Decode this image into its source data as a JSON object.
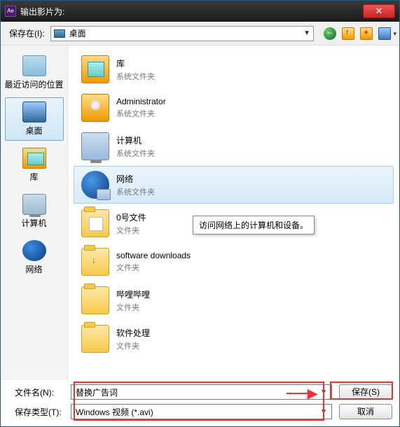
{
  "titlebar": {
    "app_badge": "Ae",
    "title": "输出影片为:"
  },
  "toolbar": {
    "savein_label": "保存在(I):",
    "location": "桌面"
  },
  "places": [
    {
      "label": "最近访问的位置",
      "icon": "recent"
    },
    {
      "label": "桌面",
      "icon": "desktop",
      "selected": true
    },
    {
      "label": "库",
      "icon": "library"
    },
    {
      "label": "计算机",
      "icon": "computer"
    },
    {
      "label": "网络",
      "icon": "network"
    }
  ],
  "listing": [
    {
      "title": "库",
      "sub": "系统文件夹",
      "icon": "lib"
    },
    {
      "title": "Administrator",
      "sub": "系统文件夹",
      "icon": "user"
    },
    {
      "title": "计算机",
      "sub": "系统文件夹",
      "icon": "comp"
    },
    {
      "title": "网络",
      "sub": "系统文件夹",
      "icon": "net",
      "selected": true,
      "tooltip": "访问网络上的计算机和设备。"
    },
    {
      "title": "0号文件",
      "sub": "文件夹",
      "icon": "folder v0"
    },
    {
      "title": "software downloads",
      "sub": "文件夹",
      "icon": "folder dl"
    },
    {
      "title": "哔哩哔哩",
      "sub": "文件夹",
      "icon": "folder"
    },
    {
      "title": "软件处理",
      "sub": "文件夹",
      "icon": "folder"
    }
  ],
  "footer": {
    "filename_label": "文件名(N):",
    "filename_value": "替换广告词",
    "filetype_label": "保存类型(T):",
    "filetype_value": "Windows 视频 (*.avi)",
    "save_btn": "保存(S)",
    "cancel_btn": "取消"
  }
}
